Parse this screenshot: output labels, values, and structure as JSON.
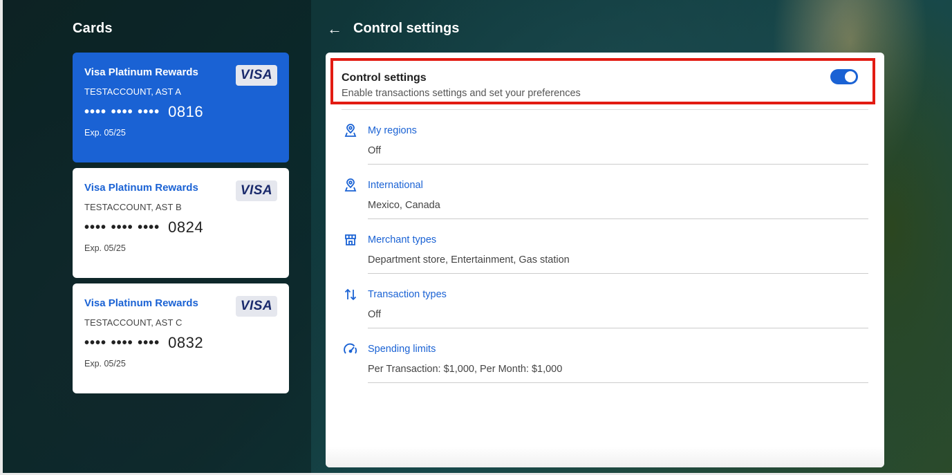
{
  "sidebar": {
    "title": "Cards",
    "cards": [
      {
        "name": "Visa Platinum Rewards",
        "holder": "TESTACCOUNT, AST A",
        "dots": "•••• •••• ••••",
        "last4": "0816",
        "exp": "Exp. 05/25",
        "brand": "VISA",
        "selected": true
      },
      {
        "name": "Visa Platinum Rewards",
        "holder": "TESTACCOUNT, AST B",
        "dots": "•••• •••• ••••",
        "last4": "0824",
        "exp": "Exp. 05/25",
        "brand": "VISA",
        "selected": false
      },
      {
        "name": "Visa Platinum Rewards",
        "holder": "TESTACCOUNT, AST C",
        "dots": "•••• •••• ••••",
        "last4": "0832",
        "exp": "Exp. 05/25",
        "brand": "VISA",
        "selected": false
      }
    ]
  },
  "header": {
    "back_icon": "←",
    "title": "Control settings"
  },
  "control": {
    "title": "Control settings",
    "subtitle": "Enable transactions settings and set your preferences",
    "toggle_on": true
  },
  "settings": [
    {
      "icon": "location-pin-icon",
      "label": "My regions",
      "value": "Off"
    },
    {
      "icon": "location-pin-icon",
      "label": "International",
      "value": "Mexico, Canada"
    },
    {
      "icon": "storefront-icon",
      "label": "Merchant types",
      "value": "Department store, Entertainment, Gas station"
    },
    {
      "icon": "swap-vertical-icon",
      "label": "Transaction types",
      "value": "Off"
    },
    {
      "icon": "speedometer-icon",
      "label": "Spending limits",
      "value": "Per Transaction: $1,000, Per Month: $1,000"
    }
  ],
  "colors": {
    "accent": "#1a62d4",
    "highlight": "#e21b12",
    "visa_text": "#1a2a6c"
  }
}
